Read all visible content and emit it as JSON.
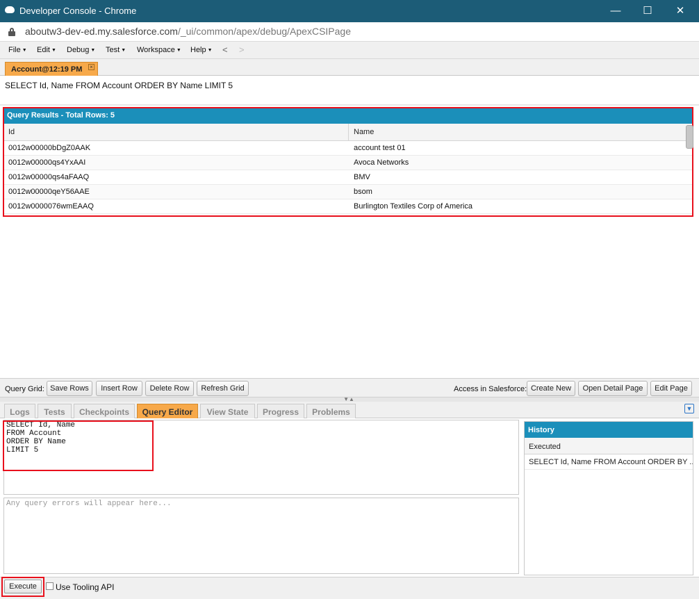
{
  "window": {
    "title": "Developer Console - Chrome",
    "controls": {
      "minimize": "—",
      "maximize": "☐",
      "close": "✕"
    }
  },
  "address_bar": {
    "url_host": "aboutw3-dev-ed.my.salesforce.com",
    "url_path": "/_ui/common/apex/debug/ApexCSIPage"
  },
  "menubar": {
    "items": [
      "File",
      "Edit",
      "Debug",
      "Test",
      "Workspace",
      "Help"
    ],
    "back": "<",
    "forward": ">"
  },
  "editor": {
    "tab_label": "Account@12:19 PM",
    "tab_close": "×",
    "query_line": "SELECT Id, Name FROM Account ORDER BY Name LIMIT 5"
  },
  "results": {
    "header": "Query Results - Total Rows: 5",
    "columns": [
      "Id",
      "Name"
    ],
    "rows": [
      [
        "0012w00000bDgZ0AAK",
        "account test 01"
      ],
      [
        "0012w00000qs4YxAAI",
        "Avoca Networks"
      ],
      [
        "0012w00000qs4aFAAQ",
        "BMV"
      ],
      [
        "0012w00000qeY56AAE",
        "bsom"
      ],
      [
        "0012w0000076wmEAAQ",
        "Burlington Textiles Corp of America"
      ]
    ]
  },
  "grid_toolbar": {
    "label": "Query Grid:",
    "buttons": [
      "Save Rows",
      "Insert Row",
      "Delete Row",
      "Refresh Grid"
    ],
    "access_label": "Access in Salesforce:",
    "access_buttons": [
      "Create New",
      "Open Detail Page",
      "Edit Page"
    ]
  },
  "bottom_tabs": {
    "items": [
      "Logs",
      "Tests",
      "Checkpoints",
      "Query Editor",
      "View State",
      "Progress",
      "Problems"
    ],
    "active": "Query Editor"
  },
  "query_editor": {
    "text": "SELECT Id, Name\nFROM Account\nORDER BY Name\nLIMIT 5",
    "errors_placeholder": "Any query errors will appear here..."
  },
  "history": {
    "title": "History",
    "column": "Executed",
    "rows": [
      "SELECT Id, Name FROM Account ORDER BY ..."
    ]
  },
  "footer": {
    "execute_label": "Execute",
    "tooling_label": "Use Tooling API",
    "tooling_checked": false
  },
  "colors": {
    "title_bar": "#1c5c77",
    "header_blue": "#1b8fba",
    "active_tab": "#f7a94a",
    "highlight_red": "#e8101c"
  }
}
